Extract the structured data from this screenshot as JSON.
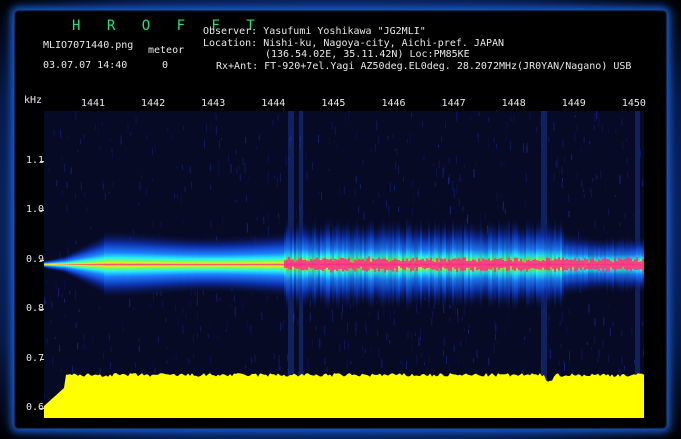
{
  "app_title": "H R O F F T",
  "file_name": "MLIO7071440.png",
  "meteor_label": "meteor",
  "meteor_count": "0",
  "datetime": "03.07.07 14:40",
  "observer_line": "Observer: Yasufumi Yoshikawa \"JG2MLI\"",
  "location_line": "Location: Nishi-ku, Nagoya-city, Aichi-pref. JAPAN",
  "coords_line": "(136.54.02E, 35.11.42N) Loc:PM85KE",
  "rx_line": "Rx+Ant: FT-920+7el.Yagi AZ50deg.EL0deg. 28.2072MHz(JR0YAN/Nagano) USB",
  "colors": {
    "frame_glow": "#1b5fd8",
    "title": "#27e07a",
    "echo_core": "#ff2e8c",
    "power_trace": "#ffff00"
  },
  "chart_data": {
    "type": "heatmap",
    "title": "",
    "xlabel": "",
    "ylabel": "kHz",
    "x_ticks": [
      "1441",
      "1442",
      "1443",
      "1444",
      "1445",
      "1446",
      "1447",
      "1448",
      "1449",
      "1450"
    ],
    "y_ticks": [
      "1.1",
      "1.0",
      "0.9",
      "0.8",
      "0.7",
      "0.6"
    ],
    "ylim": [
      0.58,
      1.2
    ],
    "x_range": [
      "1440",
      "1450"
    ],
    "signal_center_khz": 0.89,
    "grid": false
  }
}
